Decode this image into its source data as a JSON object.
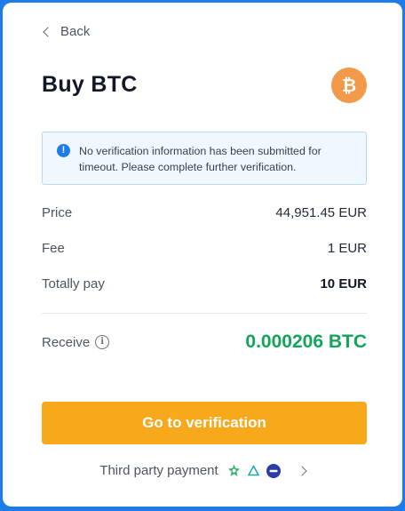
{
  "nav": {
    "back_label": "Back"
  },
  "header": {
    "title": "Buy BTC",
    "coin_icon": "bitcoin-icon",
    "coin_color": "#f2994a"
  },
  "notice": {
    "icon": "info-icon",
    "text": "No verification information has been submitted for timeout. Please complete further verification."
  },
  "summary": {
    "price_label": "Price",
    "price_value": "44,951.45 EUR",
    "fee_label": "Fee",
    "fee_value": "1 EUR",
    "total_label": "Totally pay",
    "total_value": "10 EUR"
  },
  "receive": {
    "label": "Receive",
    "value": "0.000206 BTC",
    "value_color": "#12a55a"
  },
  "cta": {
    "label": "Go to verification",
    "color": "#f7a81b"
  },
  "third_party": {
    "label": "Third party payment",
    "icons": [
      "green-star-icon",
      "triangle-logo-icon",
      "blue-circle-logo-icon"
    ]
  }
}
